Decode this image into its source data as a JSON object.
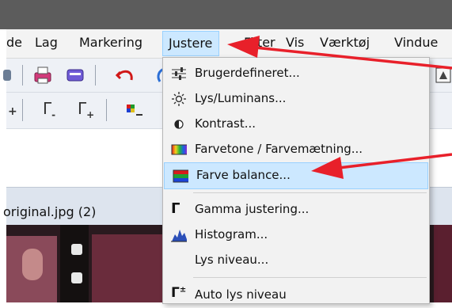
{
  "menubar": {
    "items": [
      {
        "label": "de"
      },
      {
        "label": "Lag"
      },
      {
        "label": "Markering"
      },
      {
        "label": "Justere"
      },
      {
        "label": "Filter"
      },
      {
        "label": "Vis"
      },
      {
        "label": "Værktøj"
      },
      {
        "label": "Vindue"
      }
    ]
  },
  "toolbar2": {
    "gamma_minus": "Γ",
    "gamma_plus": "Γ"
  },
  "document_tab": {
    "title": "original.jpg (2)"
  },
  "dropdown": {
    "items": [
      {
        "label": "Brugerdefineret...",
        "icon": "sliders-icon"
      },
      {
        "label": "Lys/Luminans...",
        "icon": "sun-icon"
      },
      {
        "label": "Kontrast...",
        "icon": "contrast-icon"
      },
      {
        "label": "Farvetone / Farvemætning...",
        "icon": "spectrum-icon"
      },
      {
        "label": "Farve balance...",
        "icon": "color-balance-icon",
        "highlighted": true
      },
      {
        "label": "Gamma justering...",
        "icon": "gamma-icon"
      },
      {
        "label": "Histogram...",
        "icon": "histogram-icon"
      },
      {
        "label": "Lys niveau...",
        "icon": ""
      },
      {
        "label": "Auto lys niveau",
        "icon": "auto-gamma-icon"
      }
    ]
  },
  "colors": {
    "annotation_arrow": "#e8202a",
    "menu_highlight": "#cce8ff",
    "titlebar": "#5c5c5c"
  }
}
